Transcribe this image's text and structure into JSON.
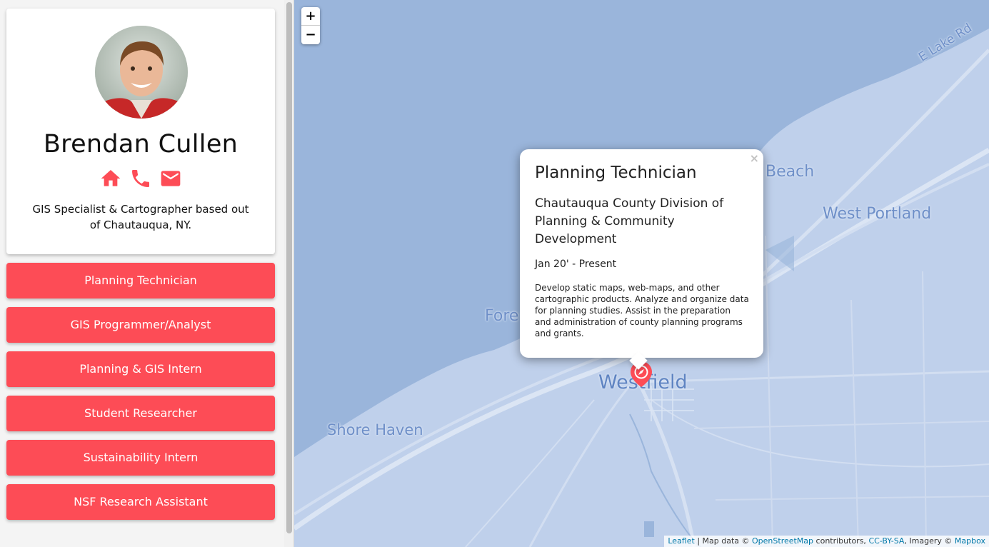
{
  "profile": {
    "name": "Brendan Cullen",
    "bio": "GIS Specialist & Cartographer based out of Chautauqua, NY.",
    "icons": [
      "home-icon",
      "phone-icon",
      "email-icon"
    ],
    "accent_color": "#fd4c56"
  },
  "jobs": [
    {
      "label": "Planning Technician"
    },
    {
      "label": "GIS Programmer/Analyst"
    },
    {
      "label": "Planning & GIS Intern"
    },
    {
      "label": "Student Researcher"
    },
    {
      "label": "Sustainability Intern"
    },
    {
      "label": "NSF Research Assistant"
    }
  ],
  "map": {
    "zoom_in": "+",
    "zoom_out": "−",
    "labels": {
      "lake_road": "E Lake Rd",
      "beach": "Beach",
      "west_portland": "West Portland",
      "fore": "Fore",
      "westfield": "Westfield",
      "shore_haven": "Shore Haven"
    },
    "water_color": "#9ab5db",
    "land_color": "#bfd0eb"
  },
  "popup": {
    "close": "×",
    "title": "Planning Technician",
    "organization": "Chautauqua County Division of Planning & Community Development",
    "dates": "Jan 20' - Present",
    "description": "Develop static maps, web-maps, and other cartographic products. Analyze and organize data for planning studies. Assist in the preparation and administration of county planning programs and grants."
  },
  "attribution": {
    "leaflet": "Leaflet",
    "sep1": " | Map data © ",
    "osm": "OpenStreetMap",
    "sep2": " contributors, ",
    "license": "CC-BY-SA",
    "sep3": ", Imagery © ",
    "mapbox": "Mapbox"
  }
}
